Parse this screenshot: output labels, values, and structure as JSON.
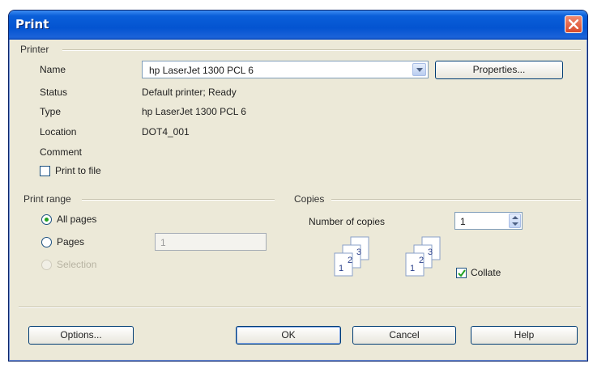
{
  "window": {
    "title": "Print"
  },
  "printer": {
    "group_label": "Printer",
    "name_label": "Name",
    "name_value": "hp LaserJet 1300 PCL 6",
    "properties_label": "Properties...",
    "status_label": "Status",
    "status_value": "Default printer; Ready",
    "type_label": "Type",
    "type_value": "hp LaserJet 1300 PCL 6",
    "location_label": "Location",
    "location_value": "DOT4_001",
    "comment_label": "Comment",
    "print_to_file_label": "Print to file",
    "print_to_file_checked": false
  },
  "print_range": {
    "group_label": "Print range",
    "all_pages_label": "All pages",
    "pages_label": "Pages",
    "pages_value": "1",
    "selection_label": "Selection",
    "selected": "all_pages"
  },
  "copies": {
    "group_label": "Copies",
    "number_label": "Number of copies",
    "number_value": "1",
    "collate_label": "Collate",
    "collate_checked": true,
    "collate_page_numbers": [
      "1",
      "2",
      "3"
    ]
  },
  "buttons": {
    "options": "Options...",
    "ok": "OK",
    "cancel": "Cancel",
    "help": "Help"
  },
  "icons": [
    "close-icon",
    "dropdown-arrow-icon",
    "checkmark-icon",
    "spin-arrows-icon",
    "collate-pages-icon"
  ]
}
